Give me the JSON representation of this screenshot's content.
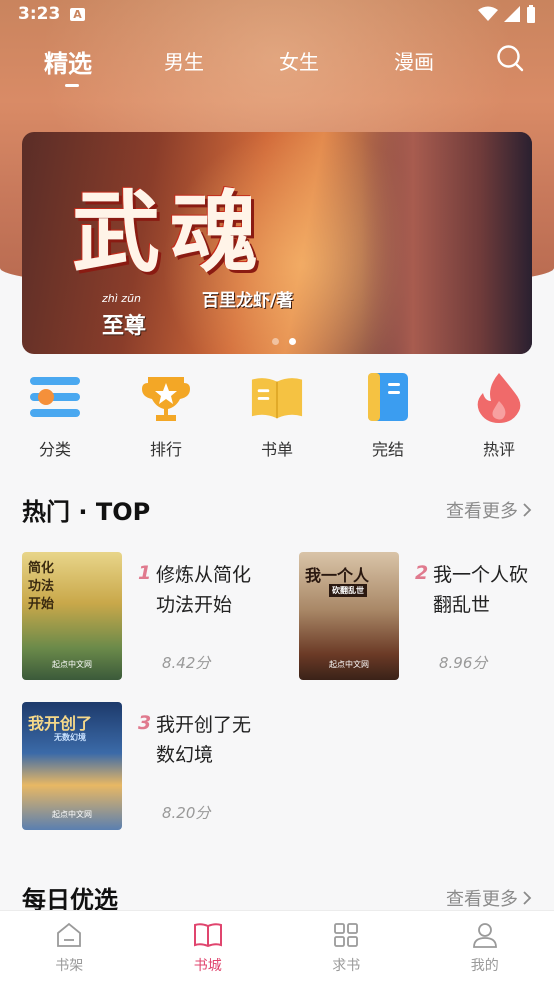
{
  "status_bar": {
    "time": "3:23",
    "sim": "A"
  },
  "tabs": [
    {
      "label": "精选",
      "active": true
    },
    {
      "label": "男生",
      "active": false
    },
    {
      "label": "女生",
      "active": false
    },
    {
      "label": "漫画",
      "active": false
    }
  ],
  "banner": {
    "title": "武魂",
    "subtitle": "至尊",
    "pinyin": "zhì zūn",
    "author": "百里龙虾/著",
    "dots": 2,
    "active_dot": 1
  },
  "categories": [
    {
      "label": "分类",
      "icon": "category-icon",
      "color": "#4aa8f0"
    },
    {
      "label": "排行",
      "icon": "trophy-icon",
      "color": "#f3a726"
    },
    {
      "label": "书单",
      "icon": "booklist-icon",
      "color": "#f5c242"
    },
    {
      "label": "完结",
      "icon": "finished-icon",
      "color": "#3b9df0"
    },
    {
      "label": "热评",
      "icon": "fire-icon",
      "color": "#f06a6a"
    }
  ],
  "hot_section": {
    "title": "热门 · TOP",
    "more": "查看更多"
  },
  "hot_books": [
    {
      "rank": "1",
      "title": "修炼从简化功法开始",
      "score": "8.42分",
      "cover_text": "简化功法开始",
      "cover_foot": "起点中文网"
    },
    {
      "rank": "2",
      "title": "我一个人砍翻乱世",
      "score": "8.96分",
      "cover_text": "我一个人",
      "cover_sub": "砍翻乱世",
      "cover_foot": "起点中文网"
    },
    {
      "rank": "3",
      "title": "我开创了无数幻境",
      "score": "8.20分",
      "cover_text": "我开创了",
      "cover_sub": "无数幻境",
      "cover_foot": "起点中文网"
    }
  ],
  "daily_section": {
    "title": "每日优选",
    "more": "查看更多"
  },
  "bottom_nav": [
    {
      "label": "书架",
      "icon": "bookshelf-icon",
      "active": false
    },
    {
      "label": "书城",
      "icon": "bookstore-icon",
      "active": true
    },
    {
      "label": "求书",
      "icon": "request-icon",
      "active": false
    },
    {
      "label": "我的",
      "icon": "profile-icon",
      "active": false
    }
  ],
  "colors": {
    "accent": "#e0456e",
    "rank": "#e07a8e",
    "header_bg": "#d98b66"
  }
}
